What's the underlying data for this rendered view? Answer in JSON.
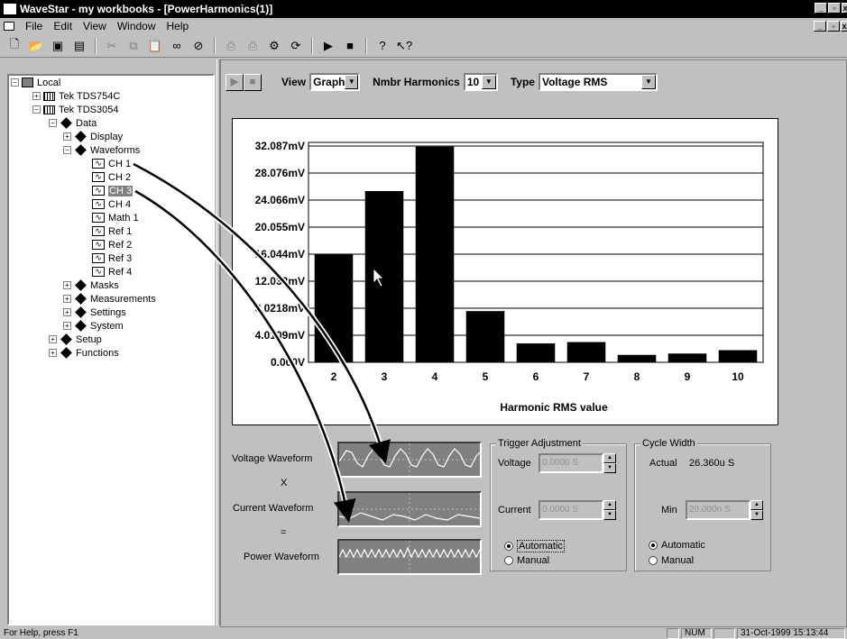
{
  "window": {
    "title": "WaveStar - my workbooks - [PowerHarmonics(1)]"
  },
  "menu": [
    "File",
    "Edit",
    "View",
    "Window",
    "Help"
  ],
  "toolbar_icons": [
    "new-icon",
    "open-icon",
    "save-icon",
    "save-all-icon",
    "cut-icon",
    "copy-icon",
    "paste-icon",
    "link-icon",
    "unlink-icon",
    "print-icon",
    "print-preview-icon",
    "properties-icon",
    "refresh-icon",
    "run-icon",
    "stop-icon",
    "help-icon",
    "context-help-icon"
  ],
  "tree": {
    "local": "Local",
    "tds754c": "Tek TDS754C",
    "tds3054": "Tek TDS3054",
    "data": "Data",
    "display": "Display",
    "waveforms": "Waveforms",
    "ch1": "CH 1",
    "ch2": "CH 2",
    "ch3": "CH 3",
    "ch4": "CH 4",
    "math1": "Math 1",
    "ref1": "Ref 1",
    "ref2": "Ref 2",
    "ref3": "Ref 3",
    "ref4": "Ref 4",
    "masks": "Masks",
    "measurements": "Measurements",
    "settings": "Settings",
    "system": "System",
    "setup": "Setup",
    "functions": "Functions"
  },
  "controls": {
    "view_label": "View",
    "view_value": "Graph",
    "nmbr_label": "Nmbr Harmonics",
    "nmbr_value": "10",
    "type_label": "Type",
    "type_value": "Voltage RMS"
  },
  "chart_data": {
    "type": "bar",
    "categories": [
      "2",
      "3",
      "4",
      "5",
      "6",
      "7",
      "8",
      "9",
      "10"
    ],
    "values": [
      16.0,
      25.4,
      32.0,
      7.6,
      2.8,
      3.0,
      1.1,
      1.3,
      1.8
    ],
    "ytick_labels": [
      "32.087mV",
      "28.076mV",
      "24.066mV",
      "20.055mV",
      "16.044mV",
      "12.033mV",
      "8.0218mV",
      "4.0109mV",
      "0.000V"
    ],
    "ytick_values": [
      32.087,
      28.076,
      24.066,
      20.055,
      16.044,
      12.033,
      8.0218,
      4.0109,
      0
    ],
    "xlabel": "Harmonic RMS value",
    "ylim": [
      0,
      32.087
    ],
    "grid": true,
    "bar_color": "#000000"
  },
  "waveforms": {
    "voltage_label": "Voltage Waveform",
    "x_label": "X",
    "current_label": "Current Waveform",
    "eq_label": "=",
    "power_label": "Power Waveform"
  },
  "trigger": {
    "title": "Trigger Adjustment",
    "voltage_label": "Voltage",
    "voltage_value": "0.0000 S",
    "current_label": "Current",
    "current_value": "0.0000 S",
    "automatic": "Automatic",
    "manual": "Manual"
  },
  "cycle": {
    "title": "Cycle Width",
    "actual_label": "Actual",
    "actual_value": "26.360u S",
    "min_label": "Min",
    "min_value": "20.000n S",
    "automatic": "Automatic",
    "manual": "Manual"
  },
  "status": {
    "help": "For Help, press F1",
    "num": "NUM",
    "datetime": "31-Oct-1999 15:13:44"
  }
}
